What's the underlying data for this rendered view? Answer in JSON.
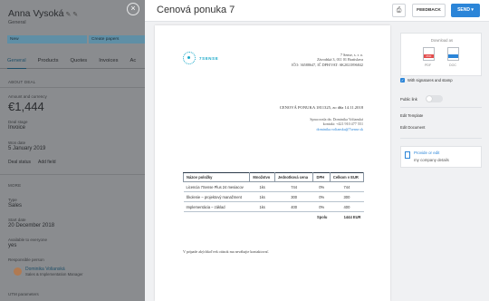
{
  "background": {
    "contact_name": "Anna Vysoká",
    "contact_sub": "General",
    "stages": [
      "New",
      "Create papers"
    ],
    "tabs": [
      "General",
      "Products",
      "Quotes",
      "Invoices",
      "Ac"
    ],
    "about_heading": "ABOUT DEAL",
    "amount_label": "Amount and currency",
    "amount_value": "€1,444",
    "stage_label": "Deal stage",
    "stage_value": "Invoice",
    "close_label": "Won date",
    "close_value": "5 January 2019",
    "link_deal_status": "Deal status",
    "link_add_field": "Add field",
    "more_heading": "MORE",
    "type_label": "Type",
    "type_value": "Sales",
    "start_label": "Start date",
    "start_value": "20 December 2018",
    "available_label": "Available to everyone",
    "available_value": "yes",
    "responsible_label": "Responsible person",
    "person_name": "Dominika Volianská",
    "person_role": "Sales & Implementation Manager",
    "utm_label": "UTM parameters"
  },
  "modal": {
    "title": "Cenová ponuka 7",
    "print_icon": "printer-icon",
    "feedback_label": "FEEDBACK",
    "send_label": "SEND"
  },
  "document": {
    "logo_text": "7SENSE",
    "company_lines": [
      "7 Sense, s. r. o.",
      "Závodská 3, 011 01 Bratislava",
      "IČO: 36588647, IČ DPH/VAT: SK2021896842"
    ],
    "offer_title": "CENOVÁ PONUKA 1811325, zo dňa 14.11.2018",
    "contact_lines": [
      "Spracovala dn. Dominika Volianská",
      "kontakt: +421 910 477 551"
    ],
    "contact_email": "dominika.volianska@7sense.sk",
    "table": {
      "headers": [
        "Názov položky",
        "Množstvo",
        "Jednotková cena",
        "DPH",
        "Celkom v EUR"
      ],
      "rows": [
        [
          "Licencia 7Sense Plus 24 mesiacov",
          "1ks",
          "744",
          "0%",
          "744"
        ],
        [
          "Školenie – projektový manažment",
          "1ks",
          "300",
          "0%",
          "300"
        ],
        [
          "Implementácia – základ",
          "1ks",
          "400",
          "0%",
          "400"
        ]
      ],
      "sum_label": "Spolu",
      "sum_value": "1444 EUR"
    },
    "note": "V prípade akýchkoľvek otázok ma neváhajte kontaktovať."
  },
  "panel": {
    "pdf_caption": "Download as",
    "pdf1_label": "PDF",
    "pdf2_label": "DOC",
    "signature_label": "With signatures and stamp",
    "public_link_label": "Public link",
    "edit_template_label": "Edit Template",
    "edit_document_label": "Edit Document",
    "provide_title": "Provide or edit",
    "provide_sub": "my company details"
  },
  "colors": {
    "accent": "#2b85d8",
    "logo": "#1aa9c9"
  }
}
